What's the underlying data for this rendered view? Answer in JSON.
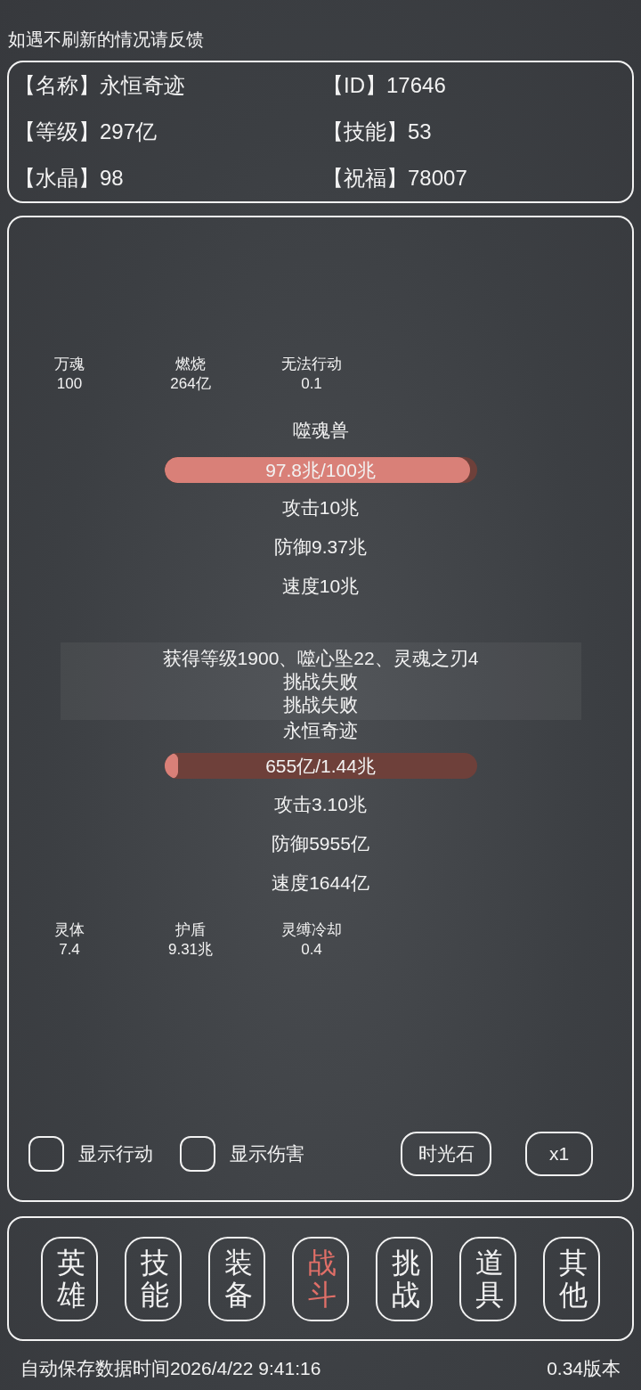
{
  "notice": "如遇不刷新的情况请反馈",
  "profile": [
    {
      "label": "【名称】",
      "value": "永恒奇迹"
    },
    {
      "label": "【ID】",
      "value": "17646"
    },
    {
      "label": "【等级】",
      "value": "297亿"
    },
    {
      "label": "【技能】",
      "value": "53"
    },
    {
      "label": "【水晶】",
      "value": "98"
    },
    {
      "label": "【祝福】",
      "value": "78007"
    }
  ],
  "battle": {
    "enemy": {
      "effects": [
        {
          "name": "万魂",
          "value": "100"
        },
        {
          "name": "燃烧",
          "value": "264亿"
        },
        {
          "name": "无法行动",
          "value": "0.1"
        }
      ],
      "name": "噬魂兽",
      "hp": {
        "text": "97.8兆/100兆",
        "level": 0.978
      },
      "stats": [
        "攻击10兆",
        "防御9.37兆",
        "速度10兆"
      ]
    },
    "log": [
      "获得等级1900、噬心坠22、灵魂之刃4",
      "挑战失败",
      "挑战失败"
    ],
    "player": {
      "name": "永恒奇迹",
      "hp": {
        "text": "655亿/1.44兆",
        "level": 0.045
      },
      "stats": [
        "攻击3.10兆",
        "防御5955亿",
        "速度1644亿"
      ],
      "effects": [
        {
          "name": "灵体",
          "value": "7.4"
        },
        {
          "name": "护盾",
          "value": "9.31兆"
        },
        {
          "name": "灵缚冷却",
          "value": "0.4"
        }
      ]
    },
    "options": [
      {
        "label": "显示行动",
        "checked": false
      },
      {
        "label": "显示伤害",
        "checked": false
      }
    ],
    "buttons": [
      "时光石",
      "x1"
    ]
  },
  "nav": [
    {
      "label": "英雄",
      "selected": false
    },
    {
      "label": "技能",
      "selected": false
    },
    {
      "label": "装备",
      "selected": false
    },
    {
      "label": "战斗",
      "selected": true
    },
    {
      "label": "挑战",
      "selected": false
    },
    {
      "label": "道具",
      "selected": false
    },
    {
      "label": "其他",
      "selected": false
    }
  ],
  "footer": {
    "autosave": "自动保存数据时间2026/4/22 9:41:16",
    "version": "0.34版本"
  }
}
